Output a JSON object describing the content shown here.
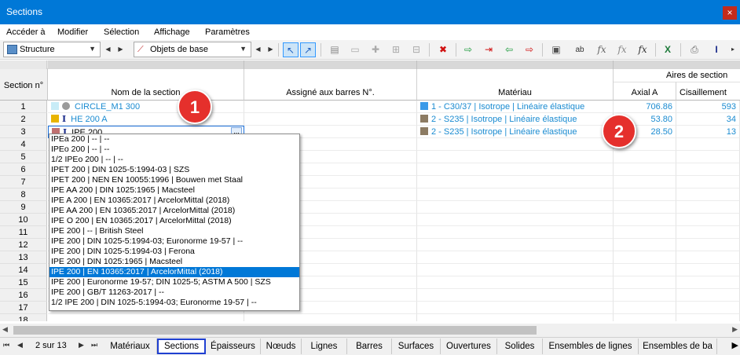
{
  "window": {
    "title": "Sections",
    "close_label": "×"
  },
  "menu": [
    "Accéder à",
    "Modifier",
    "Sélection",
    "Affichage",
    "Paramètres"
  ],
  "toolbar": {
    "structure_combo": "Structure",
    "objects_combo": "Objets de base",
    "fx_label": "fx"
  },
  "table": {
    "top_header_right": "Aires de section",
    "columns": [
      "Section n°",
      "Nom de la section",
      "Assigné aux barres N°.",
      "Matériau",
      "Axial A",
      "Cisaillement"
    ],
    "rows": [
      {
        "no": "1",
        "name": "CIRCLE_M1 300",
        "name_color": "#c8ecf7",
        "material": "1 - C30/37 | Isotrope | Linéaire élastique",
        "mat_color": "#3b9ae8",
        "axial": "706.86",
        "shear": "593"
      },
      {
        "no": "2",
        "name": "HE 200 A",
        "name_color": "#e8b400",
        "material": "2 - S235 | Isotrope | Linéaire élastique",
        "mat_color": "#8c7b63",
        "axial": "53.80",
        "shear": "34"
      },
      {
        "no": "3",
        "name": "IPE 200",
        "name_color": "#c07070",
        "material": "2 - S235 | Isotrope | Linéaire élastique",
        "mat_color": "#8c7b63",
        "axial": "28.50",
        "shear": "13"
      },
      {
        "no": "4"
      },
      {
        "no": "5"
      },
      {
        "no": "6"
      },
      {
        "no": "7"
      },
      {
        "no": "8"
      },
      {
        "no": "9"
      },
      {
        "no": "10"
      },
      {
        "no": "11"
      },
      {
        "no": "12"
      },
      {
        "no": "13"
      },
      {
        "no": "14"
      },
      {
        "no": "15"
      },
      {
        "no": "16"
      },
      {
        "no": "17"
      },
      {
        "no": "18"
      }
    ],
    "edit_button_label": "..."
  },
  "dropdown": {
    "items": [
      "IPEa 200 | -- | --",
      "IPEo 200 | -- | --",
      "1/2 IPEo 200 | -- | --",
      "IPET 200 | DIN 1025-5:1994-03 | SZS",
      "IPET 200 | NEN EN 10055:1996 | Bouwen met Staal",
      "IPE AA 200 | DIN 1025:1965 | Macsteel",
      "IPE A 200 | EN 10365:2017 | ArcelorMittal (2018)",
      "IPE AA 200 | EN 10365:2017 | ArcelorMittal (2018)",
      "IPE O 200 | EN 10365:2017 | ArcelorMittal (2018)",
      "IPE 200 | -- | British Steel",
      "IPE 200 | DIN 1025-5:1994-03; Euronorme 19-57 | --",
      "IPE 200 | DIN 1025-5:1994-03 | Ferona",
      "IPE 200 | DIN 1025:1965 | Macsteel",
      "IPE 200 | EN 10365:2017 | ArcelorMittal (2018)",
      "IPE 200 | Euronorme 19-57; DIN 1025-5; ASTM A 500 | SZS",
      "IPE 200 | GB/T 11263-2017 | --",
      "1/2 IPE 200 | DIN 1025-5:1994-03; Euronorme 19-57 | --"
    ],
    "selected_index": 13
  },
  "badges": [
    "1",
    "2"
  ],
  "pager": {
    "label": "2 sur 13"
  },
  "tabs": [
    "Matériaux",
    "Sections",
    "Épaisseurs",
    "Nœuds",
    "Lignes",
    "Barres",
    "Surfaces",
    "Ouvertures",
    "Solides",
    "Ensembles de lignes",
    "Ensembles de ba"
  ],
  "active_tab": "Sections"
}
